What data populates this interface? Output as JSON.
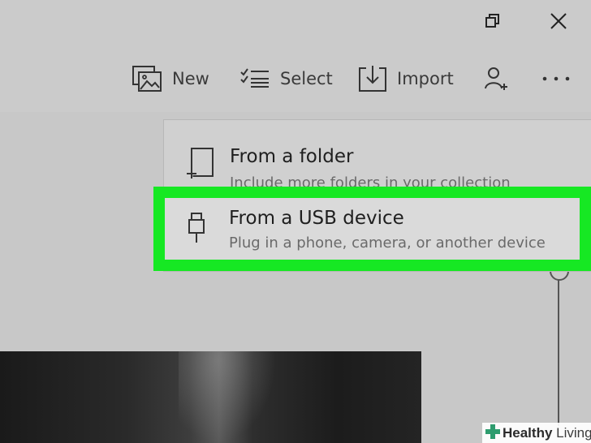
{
  "window_controls": {
    "restore_icon": "restore-icon",
    "close_icon": "close-icon"
  },
  "toolbar": {
    "new_label": "New",
    "select_label": "Select",
    "import_label": "Import",
    "people_icon": "person-add-icon",
    "more_icon": "more-icon"
  },
  "import_menu": {
    "items": [
      {
        "title": "From a folder",
        "subtitle": "Include more folders in your collection",
        "icon": "folder-add-icon"
      },
      {
        "title": "From a USB device",
        "subtitle": "Plug in a phone, camera, or another device",
        "icon": "usb-icon"
      }
    ],
    "highlight_color": "#16e823"
  },
  "watermark": {
    "bold": "Healthy",
    "rest": " Living"
  }
}
